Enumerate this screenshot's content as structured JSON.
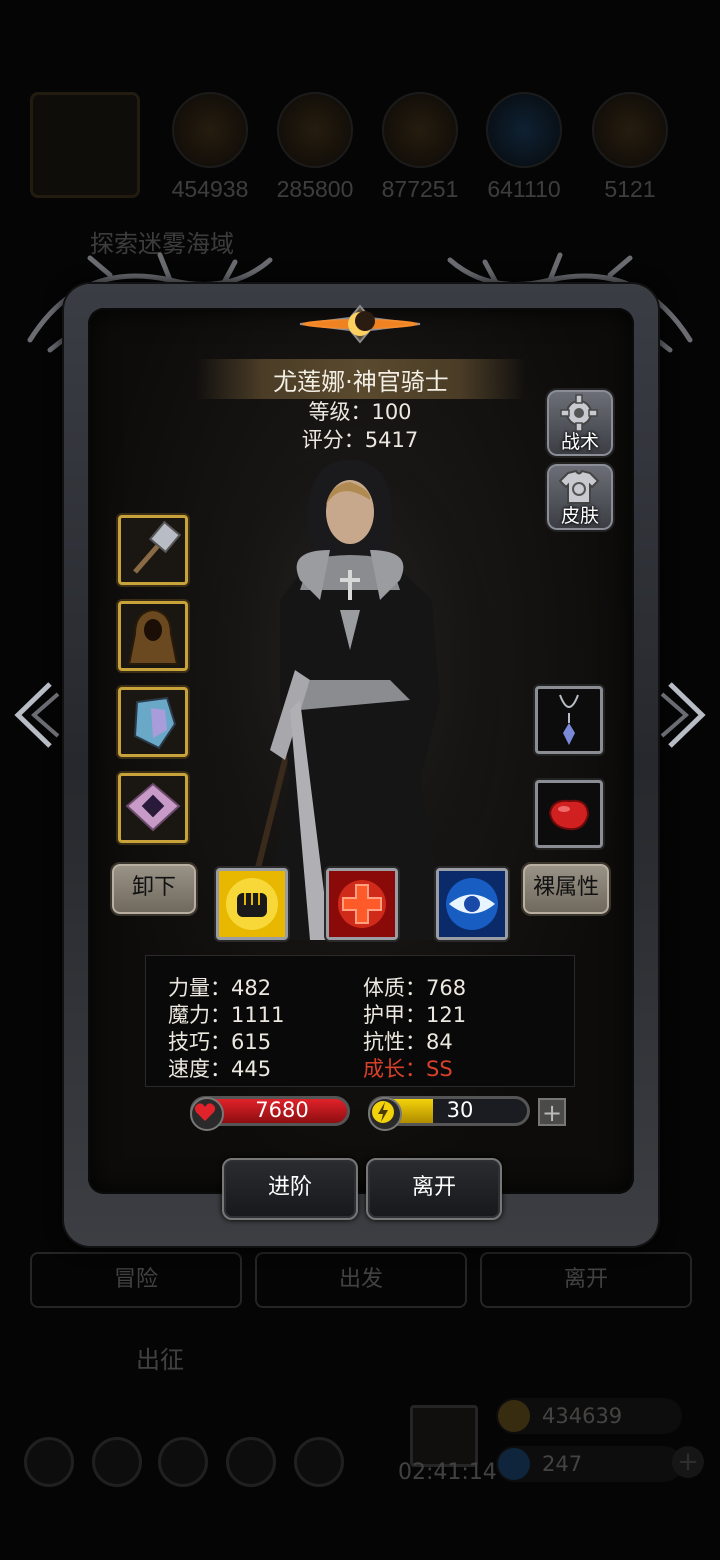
{
  "background": {
    "resources": [
      "454938",
      "285800",
      "877251",
      "641110",
      "5121"
    ],
    "explore_text": "探索迷雾海域",
    "nav_buttons": [
      "冒险",
      "出发",
      "离开"
    ],
    "sortie_label": "出征",
    "timer": "02:41:14",
    "gold": "434639",
    "gems": "247"
  },
  "hero": {
    "name": "尤莲娜·神官骑士",
    "level": "等级：100",
    "score": "评分：5417"
  },
  "side_buttons": {
    "tactics": "战术",
    "skin": "皮肤"
  },
  "actions": {
    "unequip": "卸下",
    "base_attributes": "裸属性",
    "advance": "进阶",
    "leave": "离开"
  },
  "equipment": {
    "left": [
      "hammer-icon",
      "hooded-cloak-icon",
      "crystal-shield-icon",
      "rune-scroll-icon"
    ],
    "right": [
      "necklace-icon",
      "red-gem-icon"
    ]
  },
  "skills": [
    "fist-icon",
    "cross-icon",
    "eye-icon"
  ],
  "stats": {
    "str": "力量：482",
    "con": "体质：768",
    "mag": "魔力：1111",
    "armor": "护甲：121",
    "skill": "技巧：615",
    "resist": "抗性：84",
    "speed": "速度：445",
    "growth": "成长：SS"
  },
  "bars": {
    "hp": "7680",
    "energy": "30",
    "energy_fraction": 0.4,
    "add_label": "+"
  },
  "colors": {
    "growth": "#d8402a",
    "hp": "#e0222a",
    "energy": "#f2d20a",
    "gold_frame": "#c8a23a"
  }
}
